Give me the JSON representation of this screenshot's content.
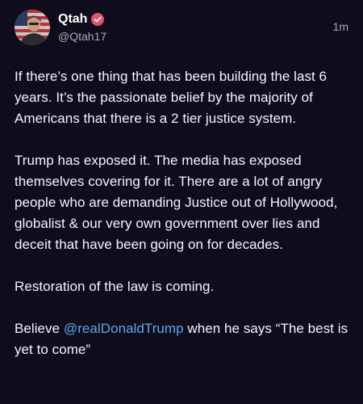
{
  "post": {
    "author": {
      "display_name": "Qtah",
      "handle": "@Qtah17",
      "verified": true,
      "avatar_icon": "avatar-photo-flag",
      "verified_color": "#e0536e"
    },
    "timestamp": "1m",
    "paragraphs": [
      "If there’s one thing that has been building the last 6 years. It’s the passionate belief by the majority of Americans that there is a 2 tier justice system.",
      "Trump has exposed it. The media has exposed themselves covering for it. There are a lot of angry people who are demanding Justice out of Hollywood, globalist & our very own government over lies and deceit that have been going on for decades.",
      "Restoration of the law is coming."
    ],
    "last_paragraph": {
      "before": "Believe ",
      "mention": "@realDonaldTrump",
      "after": " when he says “The best is yet to come”"
    }
  },
  "colors": {
    "background": "#0f0d1c",
    "text": "#f4f4f8",
    "secondary_text": "#a9a8b5",
    "mention": "#5aa8e8"
  }
}
